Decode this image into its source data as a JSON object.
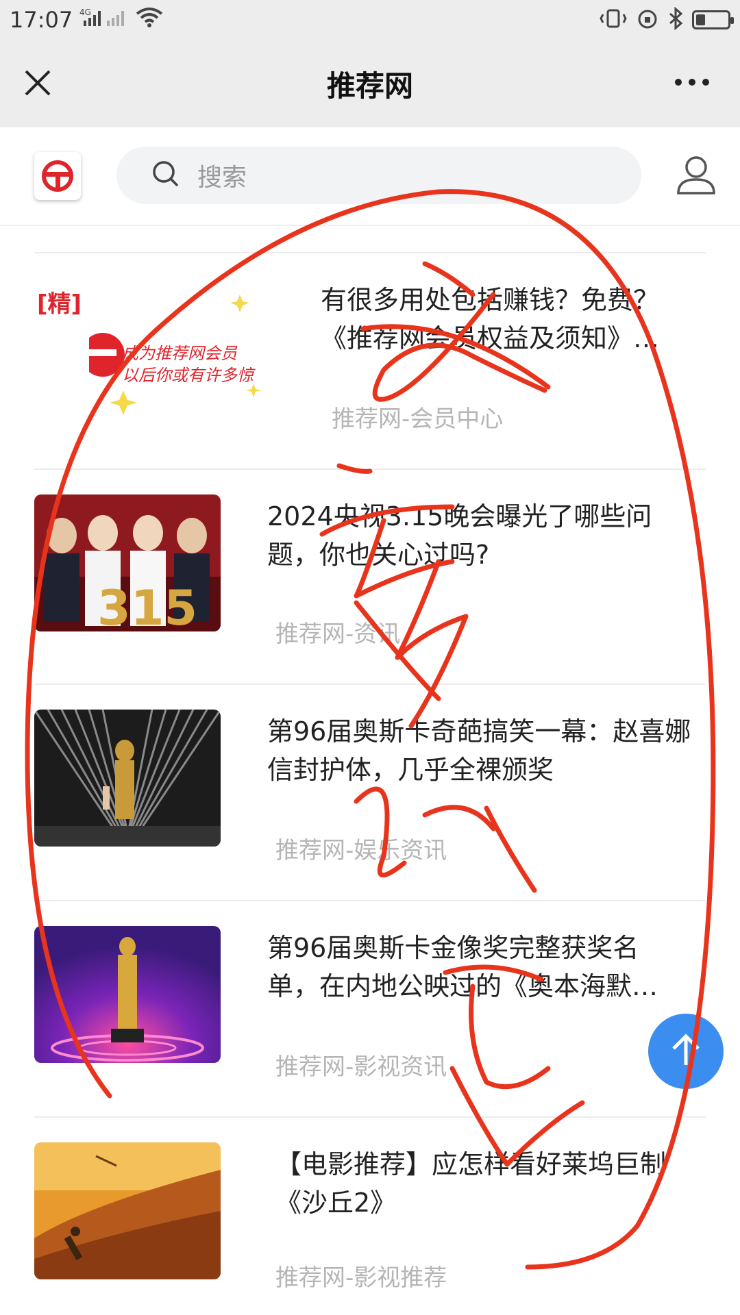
{
  "status_bar": {
    "time": "17:07",
    "network": "4G",
    "battery_percent": 30
  },
  "header": {
    "title": "推荐网"
  },
  "search": {
    "placeholder": "搜索"
  },
  "feed": {
    "items": [
      {
        "title": "有很多用处包括赚钱？免费？《推荐网会员权益及须知》…",
        "source": "推荐网-会员中心",
        "tag": "[精]",
        "banner_text_1": "成为推荐网会员",
        "banner_text_2": "以后你或有许多惊"
      },
      {
        "title": "2024央视3.15晚会曝光了哪些问题，你也关心过吗?",
        "source": "推荐网-资讯"
      },
      {
        "title": "第96届奥斯卡奇葩搞笑一幕：赵喜娜信封护体，几乎全裸颁奖",
        "source": "推荐网-娱乐资讯"
      },
      {
        "title": "第96届奥斯卡金像奖完整获奖名单，在内地公映过的《奥本海默…",
        "source": "推荐网-影视资讯"
      },
      {
        "title": "【电影推荐】应怎样看好莱坞巨制《沙丘2》",
        "source": "推荐网-影视推荐"
      }
    ]
  },
  "colors": {
    "accent": "#3c8df0",
    "brand_red": "#e0242c",
    "annotation_red": "#e8341c"
  }
}
